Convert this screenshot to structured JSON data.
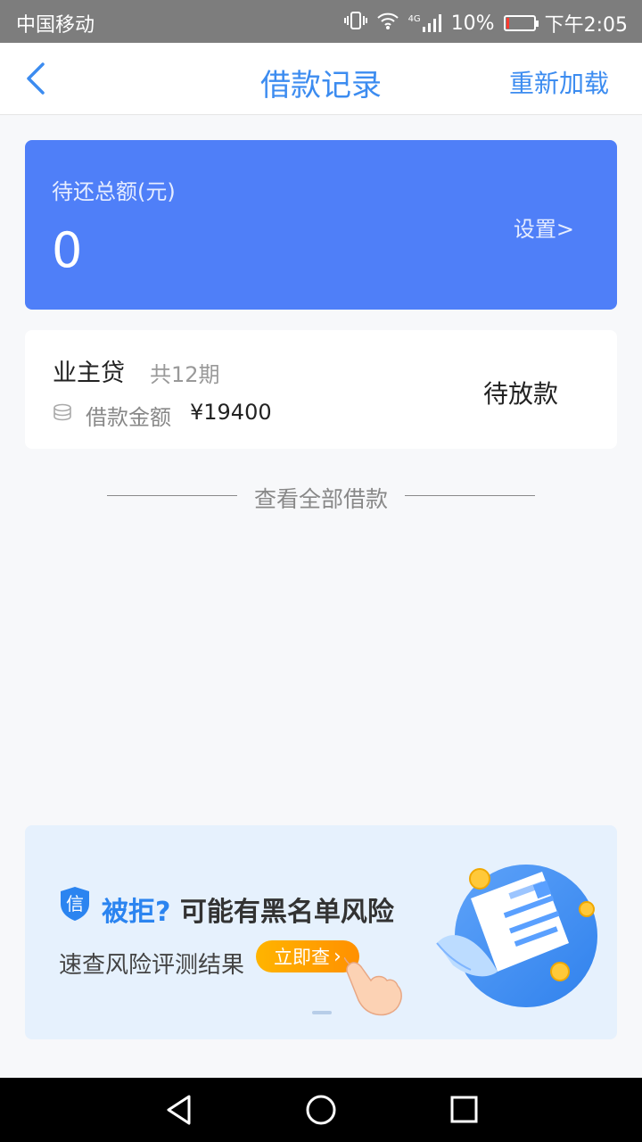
{
  "status_bar": {
    "carrier": "中国移动",
    "network": "4G",
    "battery": "10%",
    "battery_level": 0.1,
    "time": "下午2:05"
  },
  "nav": {
    "title": "借款记录",
    "reload": "重新加载"
  },
  "summary": {
    "label": "待还总额(元)",
    "amount": "0",
    "settings": "设置>"
  },
  "loan": {
    "name": "业主贷",
    "periods": "共12期",
    "amount_label": "借款金额",
    "amount_value": "¥19400",
    "status": "待放款"
  },
  "view_all": "查看全部借款",
  "banner": {
    "shield_char": "信",
    "headline_accent": "被拒?",
    "headline_rest": "可能有黑名单风险",
    "subtitle": "速查风险评测结果",
    "cta": "立即查"
  },
  "colors": {
    "accent": "#3c8cf0",
    "summary_bg": "#4f7ff8",
    "cta": "#ffa200"
  }
}
